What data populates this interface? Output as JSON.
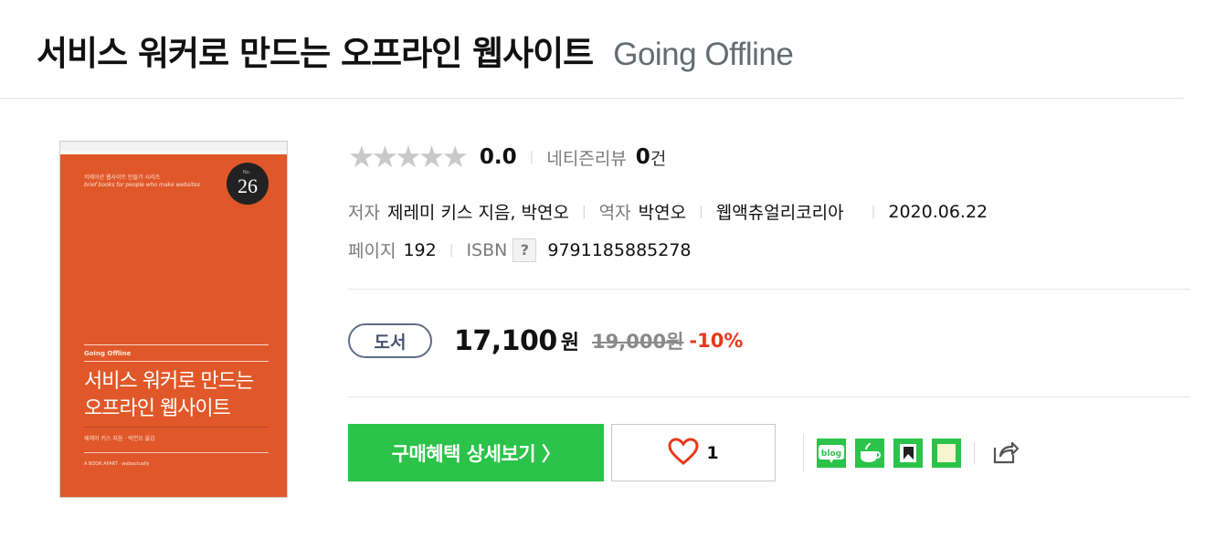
{
  "header": {
    "title_ko": "서비스 워커로 만드는 오프라인 웹사이트",
    "title_en": "Going Offline"
  },
  "cover": {
    "series_small": "저레이션 웹사이트 만들기 시리즈",
    "series_small_en": "brief books for people who make websites",
    "series_number": "26",
    "series_no_label": "No.",
    "book_en": "Going Offline",
    "title_line1": "서비스 워커로 만드는",
    "title_line2": "오프라인 웹사이트",
    "authors": "제레미 키스 지음 · 박연오 옮김",
    "publisher": "A BOOK APART · webactually"
  },
  "rating": {
    "stars": "★★★★★",
    "score": "0.0",
    "review_label": "네티즌리뷰",
    "review_count": "0",
    "review_unit": "건"
  },
  "meta": {
    "author_label": "저자",
    "author_value": "제레미 키스 지음, 박연오",
    "translator_label": "역자",
    "translator_value": "박연오",
    "publisher": "웹액츄얼리코리아",
    "date": "2020.06.22",
    "pages_label": "페이지",
    "pages_value": "192",
    "isbn_label": "ISBN",
    "isbn_help": "?",
    "isbn_value": "9791185885278"
  },
  "price": {
    "badge": "도서",
    "sale_price": "17,100",
    "won": "원",
    "original_price": "19,000원",
    "discount": "-10%"
  },
  "actions": {
    "buy_label": "구매혜택 상세보기 〉",
    "like_count": "1"
  },
  "share_icons": [
    {
      "name": "blog-icon",
      "color": "#2bc349",
      "text": "blog"
    },
    {
      "name": "cafe-icon",
      "color": "#2bc349"
    },
    {
      "name": "band-icon",
      "color": "#2bc349"
    },
    {
      "name": "memo-icon",
      "color": "#2bc349"
    }
  ],
  "colors": {
    "accent_green": "#2bc349",
    "discount_red": "#e8381c",
    "cover_orange": "#e0582a",
    "badge_navy": "#5f6d86"
  }
}
